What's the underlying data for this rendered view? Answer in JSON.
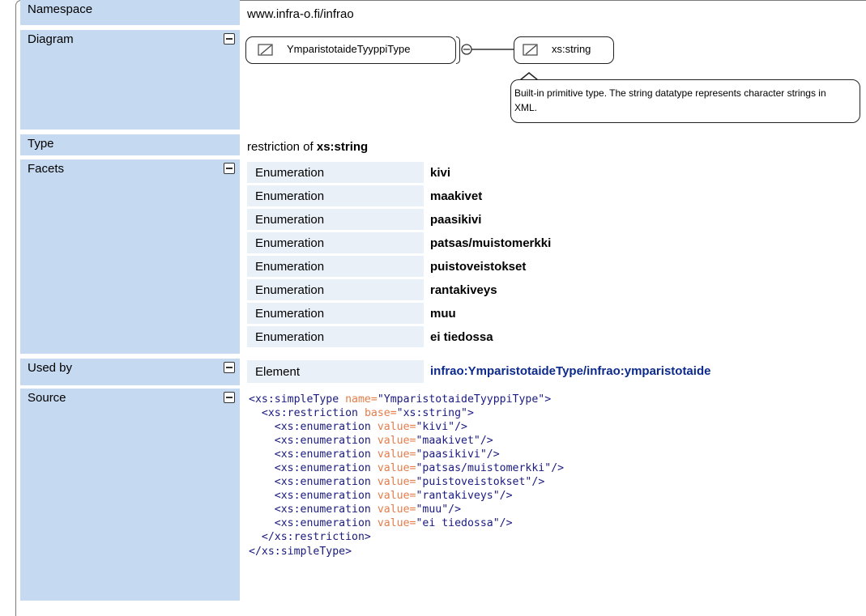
{
  "namespace": {
    "label": "Namespace",
    "value": "www.infra-o.fi/infrao"
  },
  "diagram": {
    "label": "Diagram",
    "type_node": "YmparistotaideTyyppiType",
    "base_node": "xs:string",
    "tooltip": "Built-in primitive type. The string datatype represents character strings in XML."
  },
  "type": {
    "label": "Type",
    "prefix": "restriction of ",
    "base": "xs:string"
  },
  "facets": {
    "label": "Facets",
    "rows": [
      {
        "key": "Enumeration",
        "value": "kivi"
      },
      {
        "key": "Enumeration",
        "value": "maakivet"
      },
      {
        "key": "Enumeration",
        "value": "paasikivi"
      },
      {
        "key": "Enumeration",
        "value": "patsas/muistomerkki"
      },
      {
        "key": "Enumeration",
        "value": "puistoveistokset"
      },
      {
        "key": "Enumeration",
        "value": "rantakiveys"
      },
      {
        "key": "Enumeration",
        "value": "muu"
      },
      {
        "key": "Enumeration",
        "value": "ei tiedossa"
      }
    ]
  },
  "used_by": {
    "label": "Used by",
    "kind": "Element",
    "link": "infrao:YmparistotaideType/infrao:ymparistotaide"
  },
  "source": {
    "label": "Source",
    "open_tag": "<xs:simpleType",
    "name_attr": "name=",
    "name_val": "\"YmparistotaideTyyppiType\"",
    "restriction_tag": "<xs:restriction",
    "base_attr": "base=",
    "base_val": "\"xs:string\"",
    "enum_tag": "<xs:enumeration",
    "value_attr": "value=",
    "enum_values": [
      "\"kivi\"",
      "\"maakivet\"",
      "\"paasikivi\"",
      "\"patsas/muistomerkki\"",
      "\"puistoveistokset\"",
      "\"rantakiveys\"",
      "\"muu\"",
      "\"ei tiedossa\""
    ],
    "close_restriction": "</xs:restriction>",
    "close_simpletype": "</xs:simpleType>"
  },
  "colors": {
    "label_bg": "#c5d9f1",
    "facet_bg": "#e9f0f8",
    "link": "#0c2a8c",
    "xml_attr": "#e57c4a",
    "xml_tag": "#1a1a80"
  }
}
